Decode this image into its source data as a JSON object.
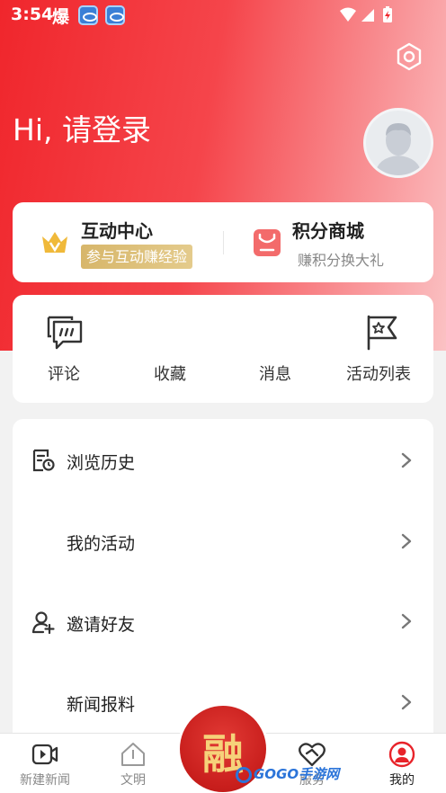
{
  "status_bar": {
    "time": "3:54",
    "notification_glyph": "爆",
    "icons": [
      "app-badge-icon",
      "app-badge-icon",
      "wifi-icon",
      "signal-icon",
      "battery-icon"
    ]
  },
  "header": {
    "greeting": "Hi, 请登录",
    "settings_icon": "settings-icon",
    "avatar_icon": "avatar-placeholder-icon"
  },
  "interaction_card": {
    "left": {
      "title": "互动中心",
      "badge": "参与互动赚经验",
      "icon": "crown-icon"
    },
    "right": {
      "title": "积分商城",
      "subtitle": "赚积分换大礼",
      "icon": "shopping-bag-icon"
    }
  },
  "quick_actions": [
    {
      "label": "评论",
      "icon": "comment-icon"
    },
    {
      "label": "收藏",
      "icon": ""
    },
    {
      "label": "消息",
      "icon": ""
    },
    {
      "label": "活动列表",
      "icon": "flag-icon"
    }
  ],
  "menu_list": [
    {
      "label": "浏览历史",
      "icon": "history-icon"
    },
    {
      "label": "我的活动",
      "icon": ""
    },
    {
      "label": "邀请好友",
      "icon": "add-user-icon"
    },
    {
      "label": "新闻报料",
      "icon": ""
    }
  ],
  "tab_bar": {
    "tabs": [
      {
        "label": "新建新闻",
        "icon": "video-icon"
      },
      {
        "label": "文明",
        "icon": "house-icon"
      },
      {
        "label": "服务",
        "icon": "handshake-icon"
      },
      {
        "label": "我的",
        "icon": "user-circle-icon",
        "active": true
      }
    ],
    "center_button_glyph": "融"
  },
  "watermark": "GOGO手游网",
  "colors": {
    "accent": "#f0262c",
    "gold": "#d7b66a",
    "tab_active": "#e8232a"
  }
}
